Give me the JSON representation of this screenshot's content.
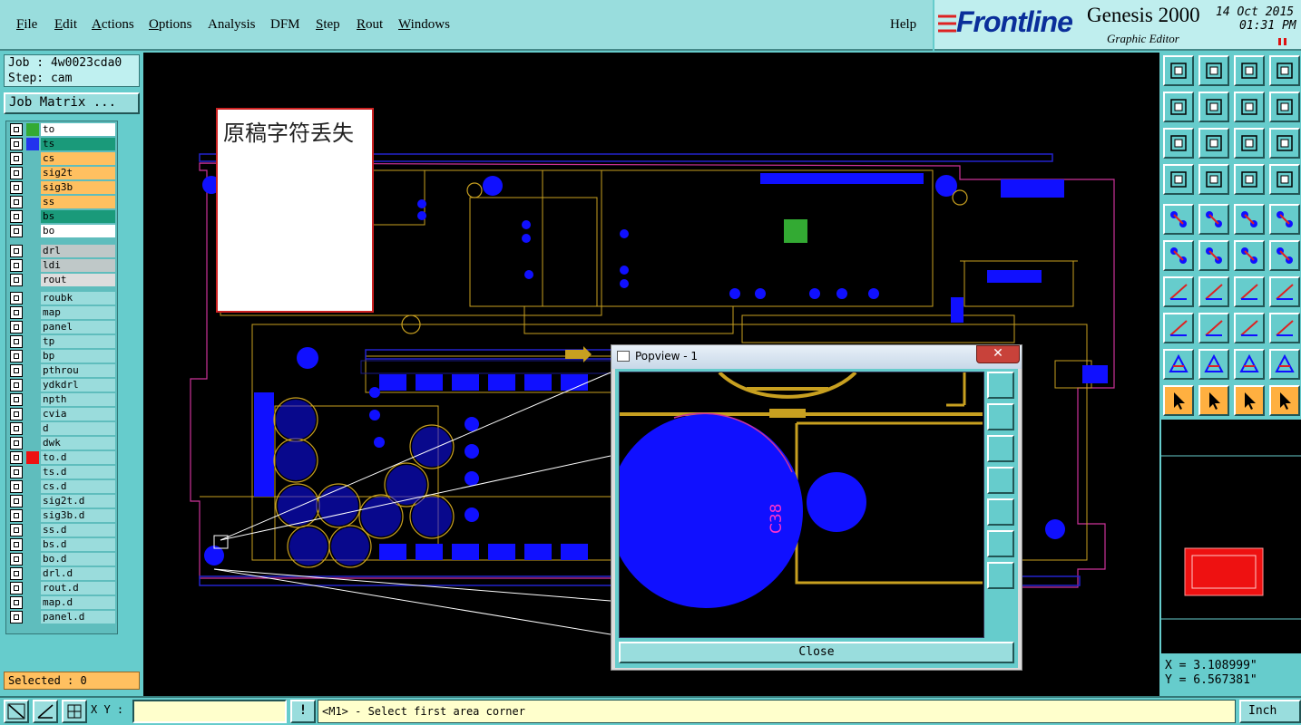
{
  "menu": {
    "items": [
      "File",
      "Edit",
      "Actions",
      "Options",
      "Analysis",
      "DFM",
      "Step",
      "Rout",
      "Windows"
    ],
    "help": "Help"
  },
  "brand": {
    "logo": "Frontline",
    "product": "Genesis 2000",
    "subtitle": "Graphic Editor",
    "date": "14 Oct 2015",
    "time": "01:31 PM"
  },
  "job": {
    "job_label": "Job : 4w0023cda0",
    "step_label": "Step: cam",
    "matrix_button": "Job Matrix ..."
  },
  "layers": {
    "board": [
      {
        "name": "to",
        "swatch": "#33aa33",
        "bg": "#ffffff"
      },
      {
        "name": "ts",
        "swatch": "#2233ee",
        "bg": "#1a9a7a"
      },
      {
        "name": "cs",
        "swatch": "",
        "bg": "#ffc060"
      },
      {
        "name": "sig2t",
        "swatch": "",
        "bg": "#ffc060"
      },
      {
        "name": "sig3b",
        "swatch": "",
        "bg": "#ffc060"
      },
      {
        "name": "ss",
        "swatch": "",
        "bg": "#ffc060"
      },
      {
        "name": "bs",
        "swatch": "",
        "bg": "#1a9a7a"
      },
      {
        "name": "bo",
        "swatch": "",
        "bg": "#ffffff"
      }
    ],
    "drill": [
      {
        "name": "drl",
        "bg": "#bfc8c8"
      },
      {
        "name": "ldi",
        "bg": "#bfc8c8"
      },
      {
        "name": "rout",
        "bg": "#dddddd"
      }
    ],
    "misc": [
      {
        "name": "roubk",
        "swatch": ""
      },
      {
        "name": "map",
        "swatch": ""
      },
      {
        "name": "panel",
        "swatch": ""
      },
      {
        "name": "tp",
        "swatch": ""
      },
      {
        "name": "bp",
        "swatch": ""
      },
      {
        "name": "pthrou",
        "swatch": ""
      },
      {
        "name": "ydkdrl",
        "swatch": ""
      },
      {
        "name": "npth",
        "swatch": ""
      },
      {
        "name": "cvia",
        "swatch": ""
      },
      {
        "name": "d",
        "swatch": ""
      },
      {
        "name": "dwk",
        "swatch": ""
      },
      {
        "name": "to.d",
        "swatch": "#ee1111"
      },
      {
        "name": "ts.d",
        "swatch": ""
      },
      {
        "name": "cs.d",
        "swatch": ""
      },
      {
        "name": "sig2t.d",
        "swatch": ""
      },
      {
        "name": "sig3b.d",
        "swatch": ""
      },
      {
        "name": "ss.d",
        "swatch": ""
      },
      {
        "name": "bs.d",
        "swatch": ""
      },
      {
        "name": "bo.d",
        "swatch": ""
      },
      {
        "name": "drl.d",
        "swatch": ""
      },
      {
        "name": "rout.d",
        "swatch": ""
      },
      {
        "name": "map.d",
        "swatch": ""
      },
      {
        "name": "panel.d",
        "swatch": ""
      }
    ],
    "misc_bg": "#9adcdc",
    "selected": "Selected : 0"
  },
  "note": {
    "text": "原稿字符丢失"
  },
  "popview": {
    "title": "Popview - 1",
    "close": "Close",
    "ref_label": "C38"
  },
  "coords": {
    "x": "X = 3.108999\"",
    "y": "Y = 6.567381\""
  },
  "status": {
    "xy_label": "X Y :",
    "xy_value": "",
    "alert": "!",
    "message": "<M1> - Select first area corner",
    "units": "Inch"
  },
  "colors": {
    "pads": "#1010ff",
    "traces": "#c8a020",
    "outline": "#cc3399",
    "silk": "#ff2222"
  }
}
